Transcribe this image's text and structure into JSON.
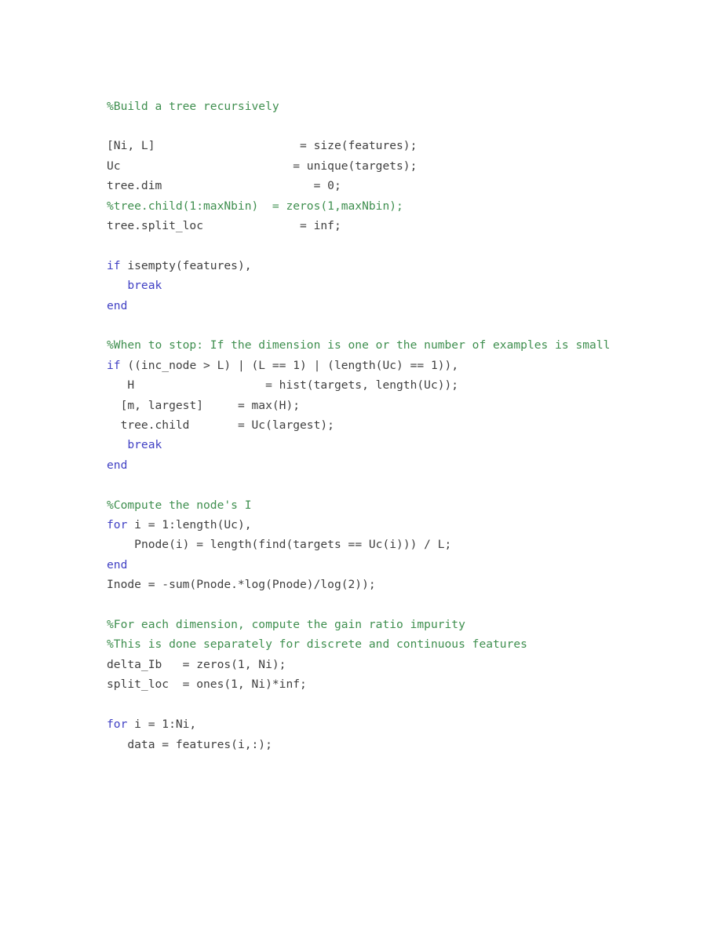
{
  "document": {
    "kind": "code-listing",
    "language": "MATLAB",
    "background_color": "#ffffff",
    "colors": {
      "plain_text": "#3f3f3f",
      "comment": "#3f8f4f",
      "keyword": "#4141c4"
    }
  },
  "code": {
    "lines": [
      {
        "type": "comment",
        "text": "%Build a tree recursively"
      },
      {
        "type": "blank",
        "text": ""
      },
      {
        "type": "plain",
        "text": "[Ni, L]                     = size(features);"
      },
      {
        "type": "plain",
        "text": "Uc                         = unique(targets);"
      },
      {
        "type": "plain",
        "text": "tree.dim                      = 0;"
      },
      {
        "type": "comment",
        "text": "%tree.child(1:maxNbin)  = zeros(1,maxNbin);"
      },
      {
        "type": "plain",
        "text": "tree.split_loc              = inf;"
      },
      {
        "type": "blank",
        "text": ""
      },
      {
        "type": "keyword-lead",
        "keyword": "if",
        "rest": " isempty(features),"
      },
      {
        "type": "keyword-indent",
        "indent": "   ",
        "keyword": "break",
        "rest": ""
      },
      {
        "type": "keyword-lead",
        "keyword": "end",
        "rest": ""
      },
      {
        "type": "blank",
        "text": ""
      },
      {
        "type": "comment",
        "text": "%When to stop: If the dimension is one or the number of examples is small"
      },
      {
        "type": "keyword-lead",
        "keyword": "if",
        "rest": " ((inc_node > L) | (L == 1) | (length(Uc) == 1)),"
      },
      {
        "type": "plain",
        "text": "   H                   = hist(targets, length(Uc));"
      },
      {
        "type": "plain",
        "text": "  [m, largest]     = max(H);"
      },
      {
        "type": "plain",
        "text": "  tree.child       = Uc(largest);"
      },
      {
        "type": "keyword-indent",
        "indent": "   ",
        "keyword": "break",
        "rest": ""
      },
      {
        "type": "keyword-lead",
        "keyword": "end",
        "rest": ""
      },
      {
        "type": "blank",
        "text": ""
      },
      {
        "type": "comment",
        "text": "%Compute the node's I"
      },
      {
        "type": "keyword-lead",
        "keyword": "for",
        "rest": " i = 1:length(Uc),"
      },
      {
        "type": "plain",
        "text": "    Pnode(i) = length(find(targets == Uc(i))) / L;"
      },
      {
        "type": "keyword-lead",
        "keyword": "end",
        "rest": ""
      },
      {
        "type": "plain",
        "text": "Inode = -sum(Pnode.*log(Pnode)/log(2));"
      },
      {
        "type": "blank",
        "text": ""
      },
      {
        "type": "comment",
        "text": "%For each dimension, compute the gain ratio impurity"
      },
      {
        "type": "comment",
        "text": "%This is done separately for discrete and continuous features"
      },
      {
        "type": "plain",
        "text": "delta_Ib   = zeros(1, Ni);"
      },
      {
        "type": "plain",
        "text": "split_loc  = ones(1, Ni)*inf;"
      },
      {
        "type": "blank",
        "text": ""
      },
      {
        "type": "keyword-lead",
        "keyword": "for",
        "rest": " i = 1:Ni,"
      },
      {
        "type": "plain",
        "text": "   data = features(i,:);"
      }
    ]
  }
}
